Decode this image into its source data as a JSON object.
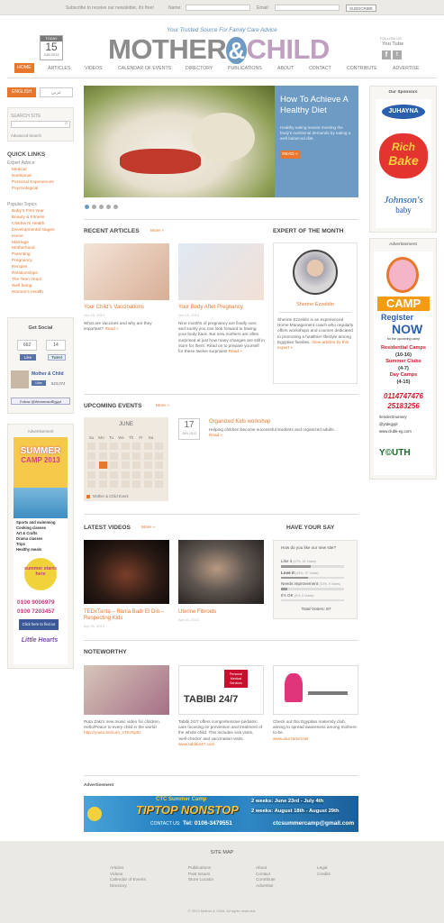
{
  "topbar": {
    "subscribe_text": "Subscribe to receive our newsletter, it's free!",
    "name_label": "Name:",
    "email_label": "Email:",
    "subscribe_btn": "SUBSCRIBE"
  },
  "header": {
    "today_label": "TODAY",
    "day": "15",
    "month": "JUN 2013",
    "tagline": "Your Trusted Source For Family Care Advice",
    "logo_left": "MOTHER",
    "logo_amp": "&",
    "logo_right": "CHILD",
    "follow": "FOLLOW US",
    "youtube": "You Tube"
  },
  "nav": [
    "HOME",
    "ARTICLES",
    "VIDEOS",
    "CALENDAR OF EVENTS",
    "DIRECTORY",
    "PUBLICATIONS",
    "ABOUT",
    "CONTACT",
    "CONTRIBUTE",
    "ADVERTISE"
  ],
  "lang": {
    "english": "ENGLISH",
    "arabic": "عربي"
  },
  "sidebar": {
    "search_label": "SEARCH SITE",
    "advanced": "Advanced Search",
    "quick_links": "QUICK LINKS",
    "expert_advice": "Expert Advice",
    "expert_items": [
      "Medical",
      "Nutritional",
      "Personal Experiences",
      "Psychological"
    ],
    "popular_topics": "Popular Topics",
    "topic_items": [
      "Baby's First Year",
      "Beauty & Fitness",
      "Children's Health",
      "Developmental stages",
      "Home",
      "Marriage",
      "Motherhood",
      "Parenting",
      "Pregnancy",
      "Recipes",
      "Relationships",
      "The Teen Years",
      "Well being",
      "Women's Health"
    ],
    "get_social": "Get Social",
    "fb_count": "662",
    "like": "Like",
    "tw_count": "14",
    "tweet": "Tweet",
    "page_name": "Mother & Child",
    "page_likes": "523,074",
    "follow_btn": "Follow @WomensofEgypt",
    "advertisement": "Advertisement"
  },
  "hero": {
    "title": "How To Achieve A Healthy Diet",
    "text": "Healthy eating means meeting the body's nutritional demands by eating a well balanced diet.",
    "read_more": "READ »"
  },
  "recent": {
    "heading": "RECENT ARTICLES",
    "more": "More »",
    "items": [
      {
        "title": "Your Child's Vaccinations",
        "date": "Jun 15, 2013",
        "text": "What are vaccines and why are they important?",
        "read": "Read »"
      },
      {
        "title": "Your Body After Pregnancy",
        "date": "Jun 12, 2013",
        "text": "Nine months of pregnancy are finally over, and surely you can look forward to having your body back. But new mothers are often surprised at just how many changes are still in store for them. Read on to prepare yourself for these twelve surprises!",
        "read": "Read »"
      }
    ]
  },
  "expert": {
    "heading": "EXPERT OF THE MONTH",
    "name": "Sherine Ezzeldin",
    "text": "Sherine Ezzeldin is an experienced Home Management coach who regularly offers workshops and courses dedicated to promoting a healthier lifestyle among Egyptian families.",
    "link": "View articles by this expert »"
  },
  "events": {
    "heading": "UPCOMING EVENTS",
    "more": "More »",
    "cal_month": "JUNE",
    "days": [
      "Su",
      "Mo",
      "Tu",
      "We",
      "Th",
      "Fr",
      "Sa"
    ],
    "legend": "Mother & Child Event",
    "event_day": "17",
    "event_month": "JUN 2013",
    "event_title": "Organized Kids workshop",
    "event_text": "Helping children become successful students and organized adults.",
    "event_read": "Read »"
  },
  "videos": {
    "heading": "LATEST VIDEOS",
    "more": "More »",
    "items": [
      {
        "title": "TEDxTanta – Rania Badr El Din – Respecting Kids",
        "date": "Apr 09, 2013"
      },
      {
        "title": "Uterine Fibroids",
        "date": "Apr 03, 2013"
      }
    ]
  },
  "poll": {
    "heading": "HAVE YOUR SAY",
    "question": "How do you like our new site?",
    "options": [
      {
        "label": "Like it",
        "meta": "(47%, 41 Votes)",
        "pct": 47
      },
      {
        "label": "Love it",
        "meta": "(43%, 37 Votes)",
        "pct": 43
      },
      {
        "label": "Needs improvement",
        "meta": "(10%, 9 Votes)",
        "pct": 10
      },
      {
        "label": "It's OK",
        "meta": "(0%, 0 Votes)",
        "pct": 0
      }
    ],
    "total": "Total Voters: 87"
  },
  "noteworthy": {
    "heading": "NOTEWORTHY",
    "items": [
      {
        "text": "Ruta Zaki's new music video for children, Hello/Peace to every child in the world!",
        "link": "http://youtu.be/cum_VOUGptU"
      },
      {
        "text": "Tabibi 24/7 offers comprehensive pediatric care focusing on prevention and treatment of the whole child. This includes sick visits, 'well-checks' and vaccination visits.",
        "link": "www.tabibi247.com"
      },
      {
        "text": "Check out this Egyptian maternity club, aiming to spread awareness among mothers-to-be.",
        "link": "www.ana7amel.net"
      }
    ]
  },
  "tabibi": {
    "top": "Personal Medical Services",
    "name": "TABIBI 24/7"
  },
  "banner": {
    "label": "Advertisement",
    "title": "CTC Summer Camp",
    "brand": "TIPTOP NONSTOP",
    "line1": "2 weeks: June 23rd - July 4th",
    "line2": "2 weeks: August 18th - August 29th",
    "contact": "CONTACT US:",
    "phone": "Tel: 0106-3479551",
    "email": "ctcsummercamp@gmail.com"
  },
  "sponsors": {
    "heading": "Our Sponsors",
    "juhayna": "JUHAYNA",
    "richbake_1": "Rich",
    "richbake_2": "Bake",
    "johnsons": "Johnson's",
    "baby": "baby",
    "advertisement": "Advertisement"
  },
  "camp_ad": {
    "camp": "CAMP",
    "register": "Register",
    "now": "NOW",
    "for": "for the upcoming camp",
    "residential": "Residential Camps",
    "r_age": "(10-16)",
    "summer": "Summer Clubs",
    "s_age": "(4-7)",
    "day": "Day Camps",
    "d_age": "(4-15)",
    "phone1": "0114747476",
    "phone2": "25183256",
    "fb": "/tenderSnursery",
    "tw": "@ytdegypt",
    "web": "www.clubk-eg.com",
    "youth": "Y©UTH"
  },
  "left_ad": {
    "summer": "SUMMER",
    "camp": "CAMP 2013",
    "items": [
      "Sports and swimming",
      "Cooking classes",
      "Art & Crafts",
      "Drama classes",
      "Trips",
      "Healthy meals"
    ],
    "summer_starts": "summer starts here",
    "ph1": "0100 9006979",
    "ph2": "0100 7203457",
    "findus": "Click here to find us",
    "hearts": "Little Hearts"
  },
  "footer": {
    "heading": "SITE MAP",
    "col1": [
      "Articles",
      "Videos",
      "Calendar of Events",
      "Directory"
    ],
    "col2": [
      "Publications",
      "Past Issues",
      "Store Locator"
    ],
    "col3": [
      "About",
      "Contact",
      "Contribute",
      "Advertise"
    ],
    "col4": [
      "Legal",
      "Credits"
    ],
    "copyright": "© 2013 Mother & Child. All rights reserved."
  },
  "colors": {
    "accent": "#e8772e",
    "hero_panel": "#6d9bc4",
    "logo_gray": "#8c8c8c"
  }
}
